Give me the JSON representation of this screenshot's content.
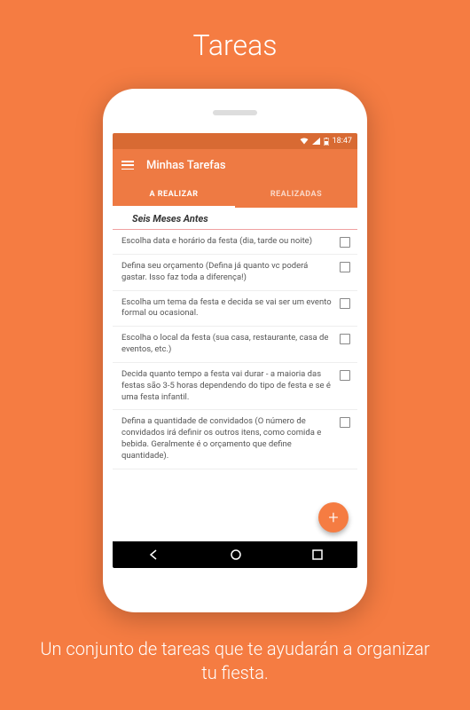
{
  "page": {
    "title": "Tareas",
    "subtitle": "Un conjunto de tareas que te ayudarán a organizar tu fiesta."
  },
  "statusBar": {
    "time": "18:47"
  },
  "appBar": {
    "title": "Minhas Tarefas"
  },
  "tabs": {
    "active": "A REALIZAR",
    "inactive": "REALIZADAS"
  },
  "section": {
    "header": "Seis Meses Antes"
  },
  "tasks": [
    {
      "text": "Escolha data e horário da festa (dia, tarde ou noite)"
    },
    {
      "text": "Defina seu orçamento (Defina já quanto vc poderá gastar. Isso faz toda a diferença!)"
    },
    {
      "text": "Escolha um tema da festa e decida se vai ser um evento formal ou ocasional."
    },
    {
      "text": "Escolha o local da festa (sua casa, restaurante, casa de eventos, etc.)"
    },
    {
      "text": "Decida quanto tempo a festa vai durar - a maioria das festas são 3-5 horas dependendo do tipo de festa e se é uma festa infantil."
    },
    {
      "text": "Defina a quantidade de convidados (O número de convidados irá definir os outros itens, como comida e bebida. Geralmente é o orçamento que define quantidade)."
    }
  ],
  "fab": {
    "label": "+"
  }
}
